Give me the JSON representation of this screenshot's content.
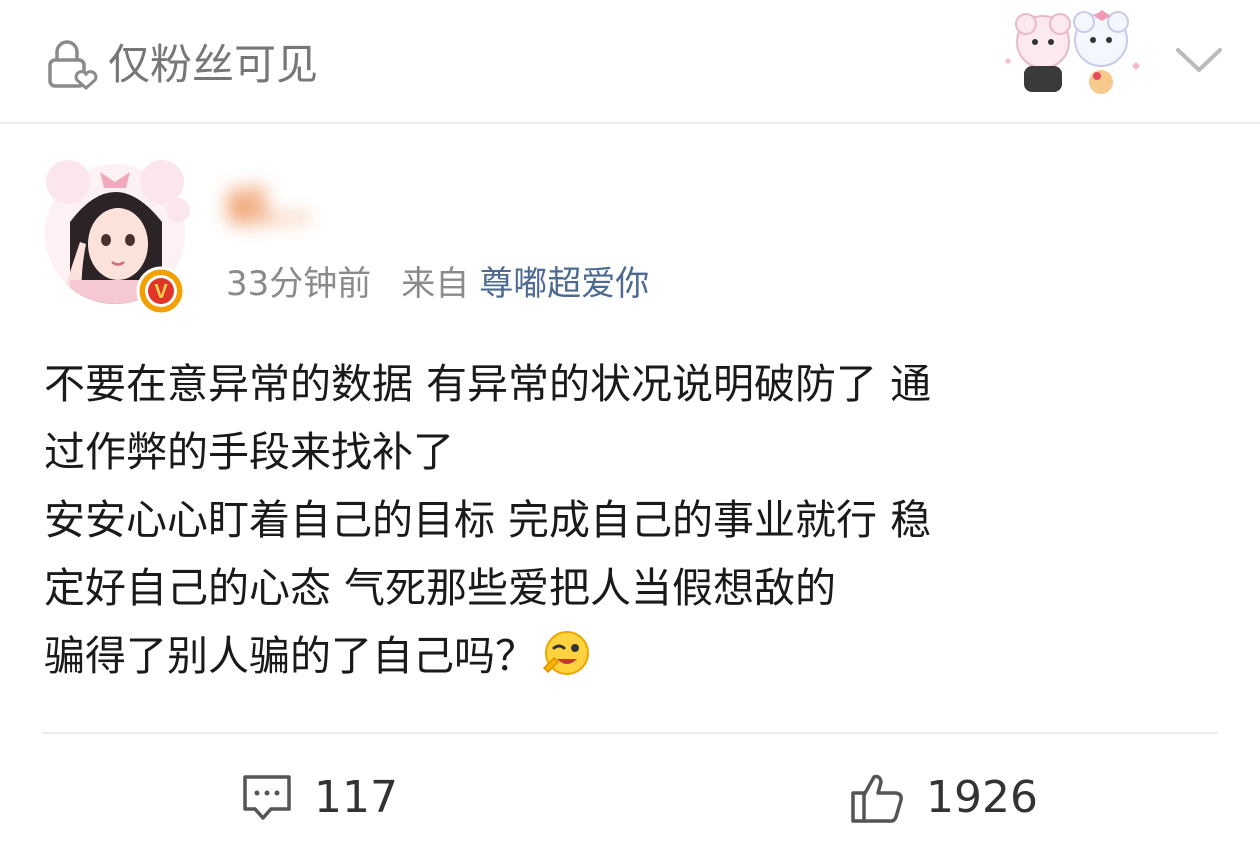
{
  "header": {
    "visibility_label": "仅粉丝可见",
    "lock_icon": "lock-heart-icon",
    "sticker": "decorative-sticker-two-bears",
    "expand_icon": "chevron-down-icon"
  },
  "author": {
    "name": "蜗…",
    "name_blurred": true,
    "time": "33分钟前",
    "from_label": "来自",
    "source": "尊嘟超爱你",
    "badge_icon": "vip-badge-icon",
    "badge_letter": "V"
  },
  "post": {
    "lines": [
      "不要在意异常的数据 有异常的状况说明破防了 通",
      "过作弊的手段来找补了",
      "安安心心盯着自己的目标 完成自己的事业就行 稳",
      "定好自己的心态 气死那些爱把人当假想敌的",
      "骗得了别人骗的了自己吗？"
    ],
    "emoji": "wink-emoji"
  },
  "actions": {
    "comment_count": "117",
    "like_count": "1926"
  },
  "colors": {
    "username": "#e8742a",
    "source_link": "#4d6a92",
    "meta": "#8a8a8a",
    "badge": "#f4a000"
  }
}
